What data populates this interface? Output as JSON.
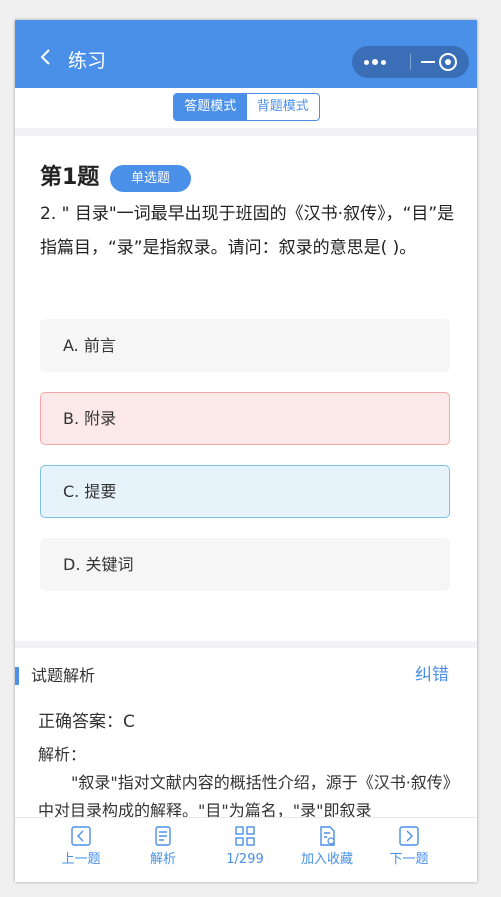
{
  "header": {
    "back_icon": "chevron-left-icon",
    "title": "练习"
  },
  "mode": {
    "tabs": [
      "答题模式",
      "背题模式"
    ],
    "active": 0
  },
  "question": {
    "number_label": "第1题",
    "type_tag": "单选题",
    "text": "2. \" 目录\"一词最早出现于班固的《汉书·叙传》，“目”是指篇目，“录”是指叙录。请问：叙录的意思是( )。"
  },
  "options": [
    {
      "label": "A. 前言",
      "state": "normal"
    },
    {
      "label": "B. 附录",
      "state": "wrong"
    },
    {
      "label": "C. 提要",
      "state": "correct"
    },
    {
      "label": "D. 关键词",
      "state": "normal"
    }
  ],
  "analysis": {
    "title": "试题解析",
    "report_link": "纠错",
    "correct_answer": "正确答案：C",
    "label": "解析：",
    "body": "\"叙录\"指对文献内容的概括性介绍，源于《汉书·叙传》中对目录构成的解释。\"目\"为篇名，\"录\"即叙录"
  },
  "bottom_nav": [
    {
      "label": "上一题",
      "icon": "prev-icon"
    },
    {
      "label": "解析",
      "icon": "document-icon"
    },
    {
      "label": "1/299",
      "icon": "grid-icon"
    },
    {
      "label": "加入收藏",
      "icon": "favorite-icon"
    },
    {
      "label": "下一题",
      "icon": "next-icon"
    }
  ],
  "colors": {
    "accent": "#4a90e8",
    "wrong_bg": "#fbe9e9",
    "correct_bg": "#e7f3fb"
  }
}
